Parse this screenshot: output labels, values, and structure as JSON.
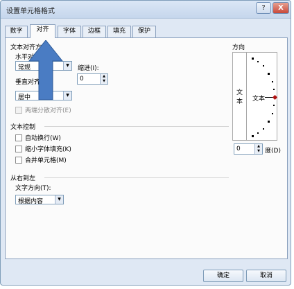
{
  "window": {
    "title": "设置单元格格式",
    "help": "?",
    "close": "X"
  },
  "tabs": [
    "数字",
    "对齐",
    "字体",
    "边框",
    "填充",
    "保护"
  ],
  "alignment": {
    "section": "文本对齐方式",
    "horizontal_label": "水平对齐",
    "horizontal_value": "常规",
    "indent_label": "缩进(I):",
    "indent_value": "0",
    "vertical_label": "垂直对齐",
    "vertical_value": "居中",
    "distributed": "两端分散对齐(E)"
  },
  "text_control": {
    "section": "文本控制",
    "wrap": "自动换行(W)",
    "shrink": "缩小字体填充(K)",
    "merge": "合并单元格(M)"
  },
  "rtl": {
    "section": "从右到左",
    "direction_label": "文字方向(T):",
    "direction_value": "根据内容"
  },
  "orientation": {
    "section": "方向",
    "vertical_chars": [
      "文",
      "本"
    ],
    "text_label": "文本",
    "degree_value": "0",
    "degree_label": "度(D)"
  },
  "buttons": {
    "ok": "确定",
    "cancel": "取消"
  },
  "colors": {
    "annotation_arrow": "#4a7cc3"
  }
}
